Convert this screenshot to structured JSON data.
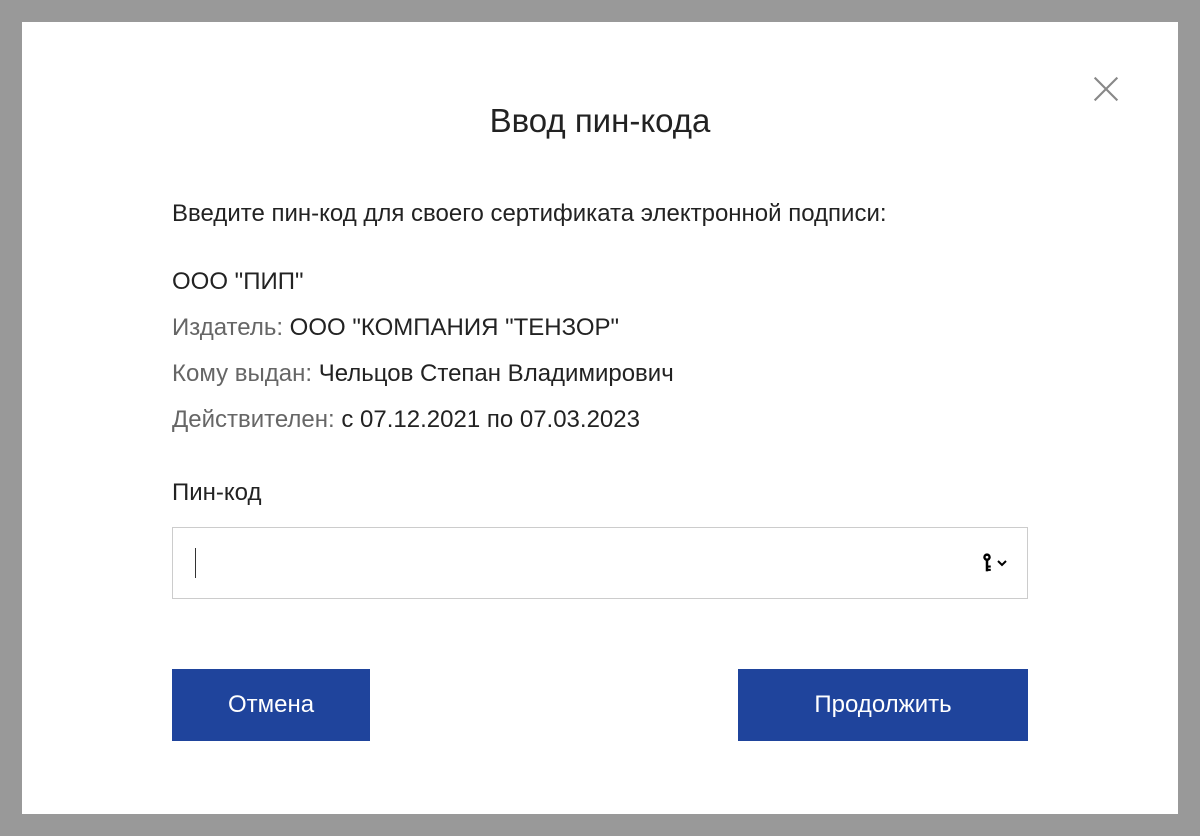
{
  "dialog": {
    "title": "Ввод пин-кода",
    "instruction": "Введите пин-код для своего сертификата электронной подписи:",
    "company": "ООО \"ПИП\"",
    "issuer_label": "Издатель: ",
    "issuer_value": "ООО \"КОМПАНИЯ \"ТЕНЗОР\"",
    "issued_to_label": "Кому выдан: ",
    "issued_to_value": "Чельцов Степан Владимирович",
    "valid_label": "Действителен: ",
    "valid_value": "с 07.12.2021  по 07.03.2023",
    "pin_label": "Пин-код",
    "pin_value": "",
    "cancel_label": "Отмена",
    "continue_label": "Продолжить"
  }
}
